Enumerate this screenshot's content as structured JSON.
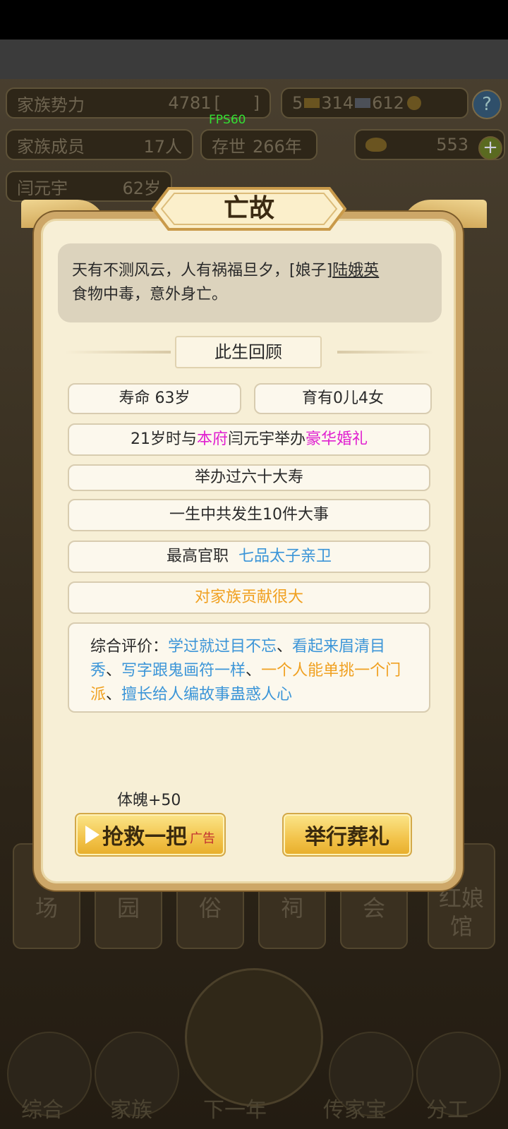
{
  "hud": {
    "influence_label": "家族势力",
    "influence_value": "4781",
    "fps": "FPS60",
    "gold_bars": "5",
    "gold_ingots": "314",
    "silver": "612",
    "members_label": "家族成员",
    "members_value": "17人",
    "years_label": "存世",
    "years_value": "266年",
    "yuanbao": "553",
    "person_name": "闫元宇",
    "person_age": "62岁",
    "help": "?",
    "plus": "+"
  },
  "bg_tiles": [
    "场",
    "园",
    "俗",
    "祠",
    "会",
    "红娘馆"
  ],
  "bottom_nav": [
    "综合",
    "家族",
    "下一年",
    "传家宝",
    "分工"
  ],
  "dialog": {
    "title": "亡故",
    "story_prefix": "天有不测风云，人有祸福旦夕，[娘子]",
    "story_name": "陆娥英",
    "story_suffix": "食物中毒，意外身亡。",
    "review_title": "此生回顾",
    "lifespan": "寿命  63岁",
    "children": "育有0儿4女",
    "marriage_prefix": "21岁时与",
    "marriage_house": "本府",
    "marriage_mid": "闫元宇举办",
    "marriage_type": "豪华婚礼",
    "birthday": "举办过六十大寿",
    "events": "一生中共发生10件大事",
    "office_label": "最高官职",
    "office_value": "七品太子亲卫",
    "contribution": "对家族贡献很大",
    "eval_label": "综合评价：",
    "traits": [
      {
        "text": "学过就过目不忘",
        "color": "#3b95d8"
      },
      {
        "text": "看起来眉清目秀",
        "color": "#3b95d8"
      },
      {
        "text": "写字跟鬼画符一样",
        "color": "#3b95d8"
      },
      {
        "text": "一个人能单挑一个门派",
        "color": "#f0a020"
      },
      {
        "text": "擅长给人编故事蛊惑人心",
        "color": "#3b95d8"
      }
    ],
    "trait_sep": "、",
    "reward": "体魄+50",
    "rescue_button": "抢救一把",
    "ad_tag": "广告",
    "funeral_button": "举行葬礼"
  }
}
